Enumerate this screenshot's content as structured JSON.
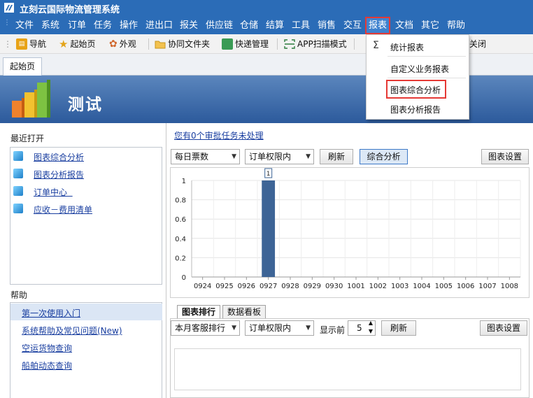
{
  "app": {
    "title": "立刻云国际物流管理系统"
  },
  "menu": [
    "文件",
    "系统",
    "订单",
    "任务",
    "操作",
    "进出口",
    "报关",
    "供应链",
    "仓储",
    "结算",
    "工具",
    "销售",
    "交互",
    "报表",
    "文档",
    "其它",
    "帮助"
  ],
  "menu_active": "报表",
  "toolbar": {
    "nav": "导航",
    "start": "起始页",
    "appearance": "外观",
    "shared_folder": "协同文件夹",
    "express": "快递管理",
    "app_scan": "APP扫描模式",
    "close": "关闭"
  },
  "tab": {
    "label": "起始页"
  },
  "banner": {
    "title": "测试"
  },
  "recent": {
    "title": "最近打开",
    "items": [
      "图表综合分析",
      "图表分析报告",
      "订单中心  ",
      "应收－费用清单"
    ]
  },
  "help": {
    "title": "帮助",
    "items": [
      "第一次使用入门",
      "系统帮助及常见问题(New)",
      "空运货物查询",
      "船舶动态查询"
    ]
  },
  "pending_link": "您有0个审批任务未处理",
  "controls_top": {
    "metric_select": "每日票数",
    "scope_select": "订单权限内",
    "refresh": "刷新",
    "analysis": "综合分析",
    "chart_settings": "图表设置"
  },
  "chart_data": {
    "type": "bar",
    "categories": [
      "0924",
      "0925",
      "0926",
      "0927",
      "0928",
      "0929",
      "0930",
      "1001",
      "1002",
      "1003",
      "1004",
      "1005",
      "1006",
      "1007",
      "1008"
    ],
    "values": [
      0,
      0,
      0,
      1,
      0,
      0,
      0,
      0,
      0,
      0,
      0,
      0,
      0,
      0,
      0
    ],
    "data_labels": {
      "0927": "1"
    },
    "ylim": [
      0,
      1
    ],
    "yticks": [
      "0",
      "0.2",
      "0.4",
      "0.6",
      "0.8",
      "1"
    ],
    "grid": true,
    "bar_color": "#3d6496"
  },
  "bottom_tabs": [
    "图表排行",
    "数据看板"
  ],
  "controls_bottom": {
    "rank_select": "本月客服排行",
    "scope_select": "订单权限内",
    "show_top_label": "显示前",
    "show_top_value": "5",
    "refresh": "刷新",
    "chart_settings": "图表设置"
  },
  "report_menu": {
    "items": [
      "统计报表",
      "自定义业务报表",
      "图表综合分析",
      "图表分析报告"
    ],
    "highlighted": "图表综合分析"
  },
  "colors": {
    "title_bar": "#2b6cb7",
    "highlight_box": "#e53935",
    "link": "#1a3fa0"
  }
}
